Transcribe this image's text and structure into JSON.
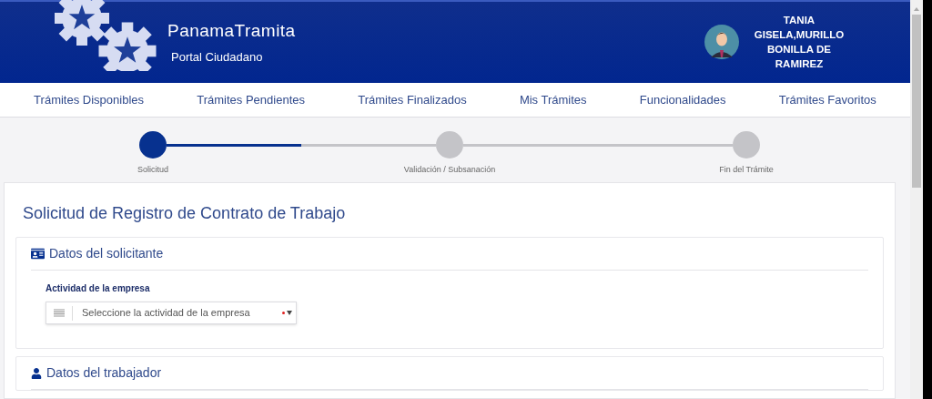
{
  "header": {
    "brand": "PanamaTramita",
    "subtitle": "Portal Ciudadano",
    "user_name": "TANIA GISELA,MURILLO BONILLA DE RAMIREZ"
  },
  "nav": [
    "Trámites Disponibles",
    "Trámites Pendientes",
    "Trámites Finalizados",
    "Mis Trámites",
    "Funcionalidades",
    "Trámites Favoritos"
  ],
  "stepper": {
    "connectors": [
      {
        "level": 0.5
      }
    ],
    "steps": [
      {
        "label": "Solicitud",
        "selected": true
      },
      {
        "label": "Validación / Subsanación",
        "selected": false
      },
      {
        "label": "Fin del Trámite",
        "selected": false
      }
    ]
  },
  "form": {
    "title": "Solicitud de Registro de Contrato de Trabajo",
    "sections": [
      {
        "kind": "applicant",
        "title": "Datos del solicitante",
        "field": {
          "label": "Actividad de la empresa",
          "placeholder": "Seleccione la actividad de la empresa",
          "required": true
        }
      },
      {
        "kind": "worker",
        "title": "Datos del trabajador"
      }
    ]
  }
}
